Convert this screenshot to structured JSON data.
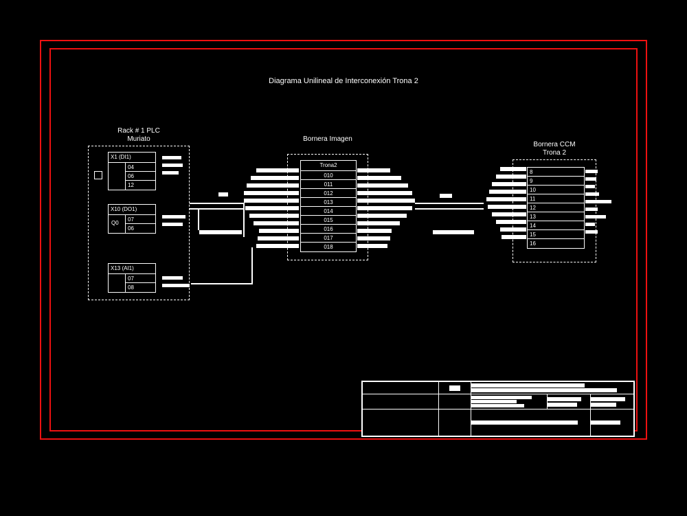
{
  "title": "Diagrama Unilineal de Interconexión Trona 2",
  "blocks": {
    "left": {
      "label": "Rack # 1 PLC\nMuriato",
      "group1_header": "X1 (DI1)",
      "group1_rows": [
        "04",
        "06",
        "12"
      ],
      "group2_header": "X10 (DO1)",
      "group2_side": "Q0",
      "group2_rows": [
        "07",
        "06"
      ],
      "group3_header": "X13 (AI1)",
      "group3_rows": [
        "07",
        "08"
      ]
    },
    "center": {
      "label": "Bornera Imagen",
      "header": "Trona2",
      "rows": [
        "010",
        "011",
        "012",
        "013",
        "014",
        "015",
        "016",
        "017",
        "018"
      ]
    },
    "right": {
      "label": "Bornera CCM\nTrona 2",
      "rows": [
        "8",
        "9",
        "10",
        "11",
        "12",
        "13",
        "14",
        "15",
        "16"
      ]
    }
  }
}
